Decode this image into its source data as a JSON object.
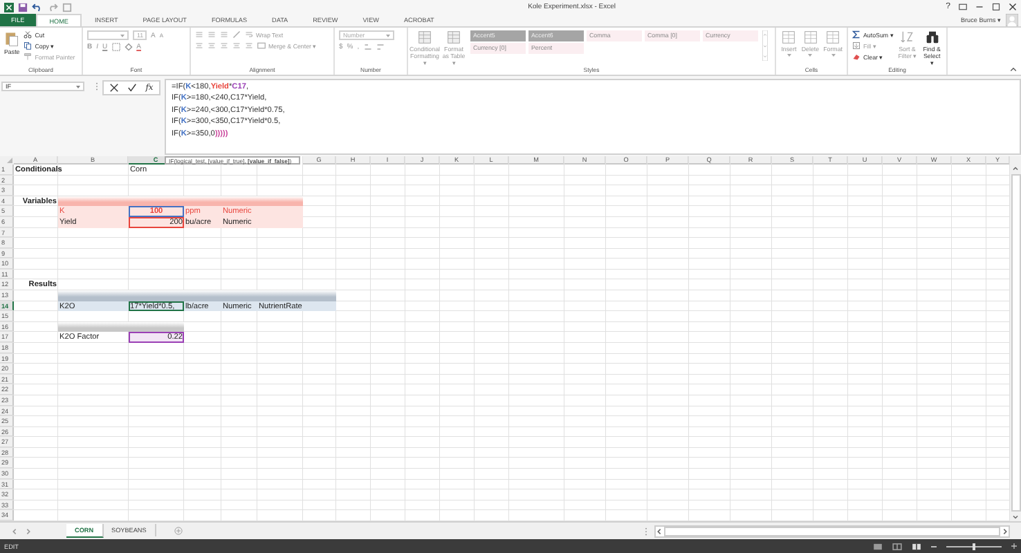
{
  "window": {
    "title": "Kole Experiment.xlsx - Excel",
    "help": "?",
    "user": "Bruce Burns ▾"
  },
  "ribbon_tabs": [
    {
      "label": "FILE",
      "kind": "file",
      "selected": false
    },
    {
      "label": "HOME",
      "kind": "tab",
      "selected": true
    },
    {
      "label": "INSERT",
      "kind": "tab",
      "selected": false
    },
    {
      "label": "PAGE LAYOUT",
      "kind": "tab",
      "selected": false
    },
    {
      "label": "FORMULAS",
      "kind": "tab",
      "selected": false
    },
    {
      "label": "DATA",
      "kind": "tab",
      "selected": false
    },
    {
      "label": "REVIEW",
      "kind": "tab",
      "selected": false
    },
    {
      "label": "VIEW",
      "kind": "tab",
      "selected": false
    },
    {
      "label": "ACROBAT",
      "kind": "tab",
      "selected": false
    }
  ],
  "ribbon_groups": [
    {
      "kind": "clipboard",
      "label": "Clipboard",
      "paste": "Paste",
      "items": [
        {
          "label": "Cut",
          "disabled": false
        },
        {
          "label": "Copy ▾",
          "disabled": false
        },
        {
          "label": "Format Painter",
          "disabled": true
        }
      ]
    },
    {
      "kind": "font",
      "label": "Font",
      "size": "11",
      "grow": "A",
      "shrink": "A",
      "bold": "B",
      "italic": "I",
      "underline": "U",
      "font_color": "A",
      "disabled": true
    },
    {
      "kind": "alignment",
      "label": "Alignment",
      "wrap": "Wrap Text",
      "merge": "Merge & Center ▾",
      "disabled": true
    },
    {
      "kind": "number",
      "label": "Number",
      "format": "Number",
      "currency": "$",
      "percent": "%",
      "comma": ",",
      "disabled": true
    },
    {
      "kind": "styles",
      "label": "Styles",
      "buttons": [
        "Conditional Formatting ▾",
        "Format as Table ▾"
      ],
      "gallery": [
        {
          "label": "Accent5",
          "kind": "accent"
        },
        {
          "label": "Accent6",
          "kind": "accent"
        },
        {
          "label": "Comma",
          "kind": "plain"
        },
        {
          "label": "Comma [0]",
          "kind": "plain"
        },
        {
          "label": "Currency",
          "kind": "plain"
        },
        {
          "label": "Currency [0]",
          "kind": "plain"
        },
        {
          "label": "Percent",
          "kind": "plain"
        }
      ],
      "disabled": true
    },
    {
      "kind": "cells",
      "label": "Cells",
      "buttons": [
        "Insert",
        "Delete",
        "Format"
      ],
      "disabled": true
    },
    {
      "kind": "editing",
      "label": "Editing",
      "items": [
        {
          "label": "AutoSum ▾",
          "disabled": false
        },
        {
          "label": "Fill ▾",
          "disabled": true
        },
        {
          "label": "Clear ▾",
          "disabled": false
        }
      ],
      "buttons": [
        {
          "label": "Sort & Filter ▾",
          "disabled": true
        },
        {
          "label": "Find & Select ▾",
          "disabled": false
        }
      ]
    }
  ],
  "formula_bar": {
    "name_box": "IF",
    "function_label": "fx",
    "lines": [
      [
        {
          "text": "=IF("
        },
        {
          "text": "K",
          "color": "#4472c4"
        },
        {
          "text": "<180,"
        },
        {
          "text": "Yield",
          "color": "#e8453c"
        },
        {
          "text": "*"
        },
        {
          "text": "C17",
          "color": "#9a3fb5"
        },
        {
          "text": ","
        }
      ],
      [
        {
          "text": "IF("
        },
        {
          "text": "K",
          "color": "#4472c4"
        },
        {
          "text": ">=180,<240,C17*Yield,"
        }
      ],
      [
        {
          "text": "IF("
        },
        {
          "text": "K",
          "color": "#4472c4"
        },
        {
          "text": ">=240,<300,C17*Yield*0.75,"
        }
      ],
      [
        {
          "text": "IF("
        },
        {
          "text": "K",
          "color": "#4472c4"
        },
        {
          "text": ">=300,<350,C17*Yield*0.5,"
        }
      ],
      [
        {
          "text": "IF("
        },
        {
          "text": "K",
          "color": "#4472c4"
        },
        {
          "text": ">=350,0"
        },
        {
          "text": ")))))",
          "color": "#c9449b"
        }
      ]
    ],
    "tooltip": "IF(logical_test, [value_if_true], **[value_if_false]**)"
  },
  "sheet": {
    "columns": [
      {
        "label": "A",
        "selected": false
      },
      {
        "label": "B",
        "selected": false
      },
      {
        "label": "C",
        "selected": true
      },
      {},
      {},
      {},
      {
        "label": "G",
        "selected": false
      },
      {
        "label": "H",
        "selected": false
      },
      {
        "label": "I",
        "selected": false
      },
      {
        "label": "J",
        "selected": false
      },
      {
        "label": "K",
        "selected": false
      },
      {
        "label": "L",
        "selected": false
      },
      {
        "label": "M",
        "selected": false
      },
      {
        "label": "N",
        "selected": false
      },
      {
        "label": "O",
        "selected": false
      },
      {
        "label": "P",
        "selected": false
      },
      {
        "label": "Q",
        "selected": false
      },
      {
        "label": "R",
        "selected": false
      },
      {
        "label": "S",
        "selected": false
      },
      {
        "label": "T",
        "selected": false
      },
      {
        "label": "U",
        "selected": false
      },
      {
        "label": "V",
        "selected": false
      },
      {
        "label": "W",
        "selected": false
      },
      {
        "label": "X",
        "selected": false
      },
      {
        "label": "Y",
        "selected": false
      }
    ],
    "rows": [
      {
        "number": "1",
        "selected": false,
        "cells": [
          {
            "text": "Conditionals",
            "kind": "title"
          },
          {},
          {
            "text": "Corn",
            "kind": "text"
          }
        ]
      },
      {
        "number": "2",
        "selected": false
      },
      {
        "number": "3",
        "selected": false
      },
      {
        "number": "4",
        "selected": false,
        "cells": [
          {
            "text": "Variables",
            "kind": "section"
          },
          {
            "fill": {
              "color": "#f8b4ac",
              "heading": true
            }
          },
          {
            "fill": {
              "color": "#f8b4ac",
              "heading": true
            }
          },
          {
            "fill": {
              "color": "#f8b4ac",
              "heading": true
            }
          },
          {
            "fill": {
              "color": "#f8b4ac",
              "heading": true
            }
          },
          {
            "fill": {
              "color": "#f8b4ac",
              "heading": true
            }
          }
        ]
      },
      {
        "number": "5",
        "selected": false,
        "cells": [
          {},
          {
            "text": "K",
            "kind": "text",
            "color": "#e8453c",
            "fill": {
              "color": "#fde4e1",
              "heading": false
            }
          },
          {
            "text": "100",
            "kind": "centered",
            "color": "#e8453c",
            "fill": {
              "color": "#fde4e1",
              "heading": false
            },
            "reference": {
              "color": "#4472c4"
            }
          },
          {
            "text": "ppm",
            "kind": "text",
            "color": "#e8453c",
            "fill": {
              "color": "#fde4e1",
              "heading": false
            }
          },
          {
            "text": "Numeric",
            "kind": "text",
            "color": "#e8453c",
            "fill": {
              "color": "#fde4e1",
              "heading": false
            }
          },
          {
            "fill": {
              "color": "#fde4e1",
              "heading": false
            }
          }
        ]
      },
      {
        "number": "6",
        "selected": false,
        "cells": [
          {},
          {
            "text": "Yield",
            "kind": "text",
            "fill": {
              "color": "#fde4e1",
              "heading": false
            }
          },
          {
            "text": "200",
            "kind": "number",
            "fill": {
              "color": "#fde4e1",
              "heading": false
            },
            "reference": {
              "color": "#e8453c"
            }
          },
          {
            "text": "bu/acre",
            "kind": "text",
            "fill": {
              "color": "#fde4e1",
              "heading": false
            }
          },
          {
            "text": "Numeric",
            "kind": "text",
            "fill": {
              "color": "#fde4e1",
              "heading": false
            }
          },
          {
            "fill": {
              "color": "#fde4e1",
              "heading": false
            }
          }
        ]
      },
      {
        "number": "7",
        "selected": false
      },
      {
        "number": "8",
        "selected": false
      },
      {
        "number": "9",
        "selected": false
      },
      {
        "number": "10",
        "selected": false
      },
      {
        "number": "11",
        "selected": false
      },
      {
        "number": "12",
        "selected": false,
        "cells": [
          {
            "text": "Results",
            "kind": "section"
          }
        ]
      },
      {
        "number": "13",
        "selected": false,
        "cells": [
          {},
          {
            "fill": {
              "color": "#b4bfcb",
              "heading": true
            }
          },
          {
            "fill": {
              "color": "#b4bfcb",
              "heading": true
            }
          },
          {
            "fill": {
              "color": "#b4bfcb",
              "heading": true
            }
          },
          {
            "fill": {
              "color": "#b4bfcb",
              "heading": true
            }
          },
          {
            "fill": {
              "color": "#b4bfcb",
              "heading": true
            }
          },
          {
            "fill": {
              "color": "#b4bfcb",
              "heading": true
            }
          }
        ]
      },
      {
        "number": "14",
        "selected": true,
        "cells": [
          {},
          {
            "text": "K2O",
            "kind": "text",
            "fill": {
              "color": "#dde6ef",
              "heading": false
            }
          },
          {
            "text": "17*Yield*0.5,",
            "kind": "text",
            "fill": {
              "color": "#dde6ef",
              "heading": false
            },
            "reference": {
              "color": "#217346"
            }
          },
          {
            "text": "lb/acre",
            "kind": "text",
            "fill": {
              "color": "#dde6ef",
              "heading": false
            }
          },
          {
            "text": "Numeric",
            "kind": "text",
            "fill": {
              "color": "#dde6ef",
              "heading": false
            }
          },
          {
            "text": "NutrientRate",
            "kind": "text",
            "fill": {
              "color": "#dde6ef",
              "heading": false
            }
          },
          {
            "fill": {
              "color": "#dde6ef",
              "heading": false
            }
          }
        ]
      },
      {
        "number": "15",
        "selected": false
      },
      {
        "number": "16",
        "selected": false,
        "cells": [
          {},
          {
            "fill": {
              "color": "#c8c8c8",
              "heading": true
            }
          },
          {
            "fill": {
              "color": "#c8c8c8",
              "heading": true
            }
          }
        ]
      },
      {
        "number": "17",
        "selected": false,
        "cells": [
          {},
          {
            "text": "K2O Factor",
            "kind": "text"
          },
          {
            "text": "0.22",
            "kind": "number",
            "reference": {
              "color": "#9a3fb5"
            }
          }
        ]
      },
      {
        "number": "18",
        "selected": false
      },
      {
        "number": "19",
        "selected": false
      },
      {
        "number": "20",
        "selected": false
      },
      {
        "number": "21",
        "selected": false
      },
      {
        "number": "22",
        "selected": false
      },
      {
        "number": "23",
        "selected": false
      },
      {
        "number": "24",
        "selected": false
      },
      {
        "number": "25",
        "selected": false
      },
      {
        "number": "26",
        "selected": false
      },
      {
        "number": "27",
        "selected": false
      },
      {
        "number": "28",
        "selected": false
      },
      {
        "number": "29",
        "selected": false
      },
      {
        "number": "30",
        "selected": false
      },
      {
        "number": "31",
        "selected": false
      },
      {
        "number": "32",
        "selected": false
      },
      {
        "number": "33",
        "selected": false
      },
      {
        "number": "34",
        "selected": false
      }
    ]
  },
  "sheet_tabs": [
    {
      "label": "CORN",
      "selected": true
    },
    {
      "label": "SOYBEANS",
      "selected": false
    }
  ],
  "status_bar": {
    "mode": "EDIT",
    "zoom": {
      "level": 0.5
    }
  }
}
